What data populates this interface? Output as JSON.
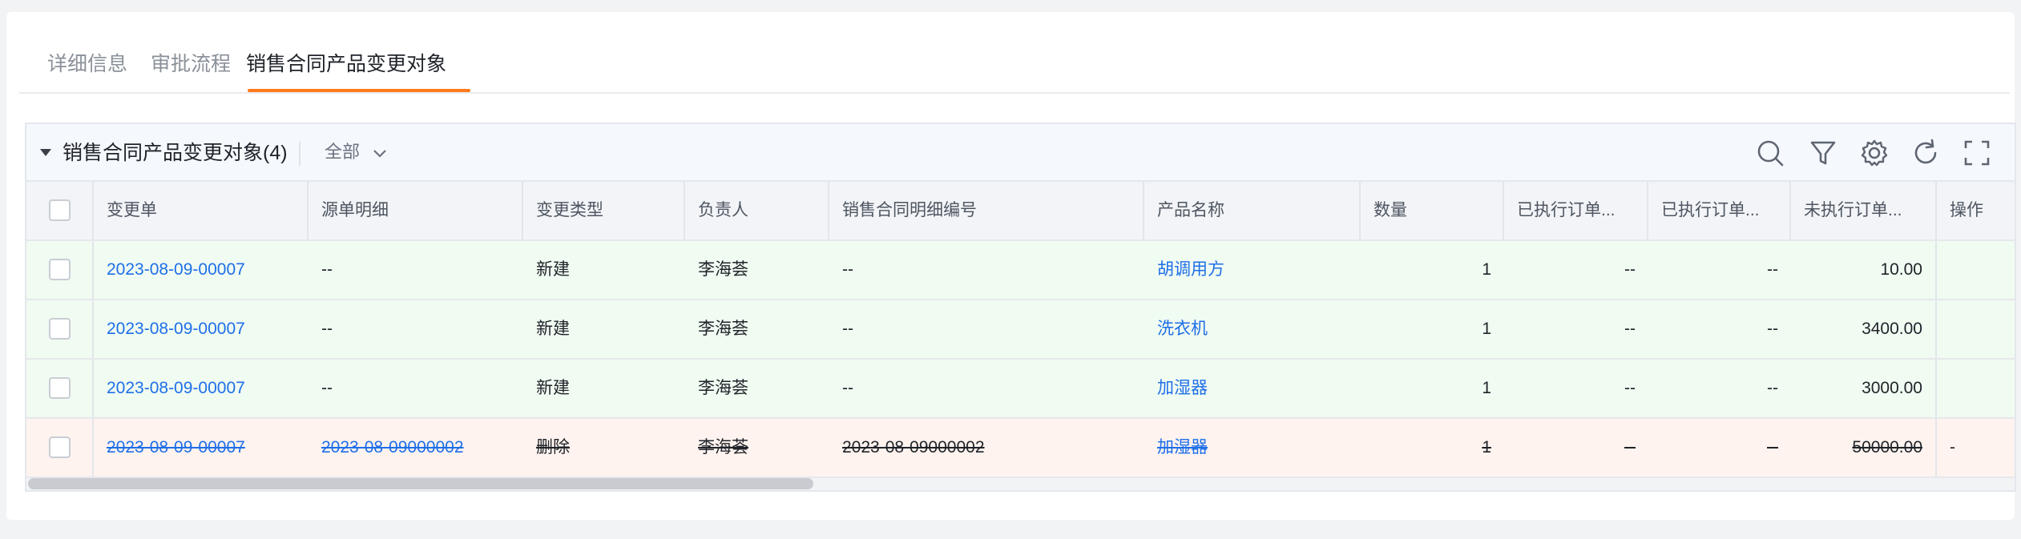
{
  "tabs": [
    {
      "label": "详细信息"
    },
    {
      "label": "审批流程"
    },
    {
      "label": "销售合同产品变更对象",
      "active": true
    }
  ],
  "panel": {
    "title": "销售合同产品变更对象(4)",
    "filter": "全部",
    "icons": [
      "search-icon",
      "filter-icon",
      "settings-icon",
      "refresh-icon",
      "fullscreen-icon"
    ]
  },
  "table": {
    "headers": [
      "变更单",
      "源单明细",
      "变更类型",
      "负责人",
      "销售合同明细编号",
      "产品名称",
      "数量",
      "已执行订单...",
      "已执行订单...",
      "未执行订单...",
      "操作"
    ],
    "rows": [
      {
        "change": "2023-08-09-00007",
        "source": "--",
        "type": "新建",
        "owner": "李海荟",
        "contract_no": "--",
        "product": "胡调用方",
        "qty": "1",
        "exec1": "--",
        "exec2": "--",
        "unexec": "10.00",
        "op": ""
      },
      {
        "change": "2023-08-09-00007",
        "source": "--",
        "type": "新建",
        "owner": "李海荟",
        "contract_no": "--",
        "product": "洗衣机",
        "qty": "1",
        "exec1": "--",
        "exec2": "--",
        "unexec": "3400.00",
        "op": ""
      },
      {
        "change": "2023-08-09-00007",
        "source": "--",
        "type": "新建",
        "owner": "李海荟",
        "contract_no": "--",
        "product": "加湿器",
        "qty": "1",
        "exec1": "--",
        "exec2": "--",
        "unexec": "3000.00",
        "op": ""
      },
      {
        "change": "2023-08-09-00007",
        "source": "2023-08-09000002",
        "type": "删除",
        "owner": "李海荟",
        "contract_no": "2023-08-09000002",
        "product": "加湿器",
        "qty": "1",
        "exec1": "--",
        "exec2": "--",
        "unexec": "50000.00",
        "op": "-"
      }
    ]
  },
  "colors": {
    "accent": "#ff7a1a",
    "link": "#1e6fe8",
    "new_row_bg": "#f0fbf2",
    "deleted_row_bg": "#fff3ef"
  }
}
